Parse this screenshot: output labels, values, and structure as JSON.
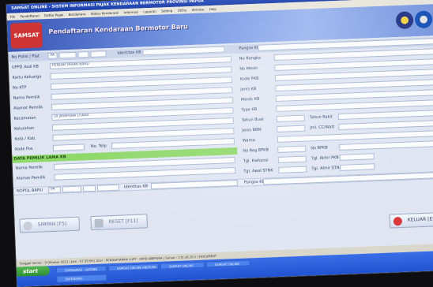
{
  "window": {
    "title": "SAMSAT ONLINE - SISTEM INFORMASI PAJAK KENDARAAN BERMOTOR PROVINSI PAPUA"
  },
  "menu": {
    "items": [
      "File",
      "Pendaftaran",
      "Daftar Pajak",
      "Bendahara",
      "Status Kendaraan",
      "Informasi",
      "Laporan",
      "Setting",
      "Utility",
      "Window",
      "Help"
    ]
  },
  "banner": {
    "logo_text": "SAMSAT",
    "title": "Pendaftaran Kendaraan Bermotor Baru",
    "emblem_1": "shield-emblem-icon",
    "emblem_2": "papua-emblem-icon"
  },
  "form": {
    "nopolisi_label": "No Polisi / Plat",
    "nopolisi_prefix": "PA",
    "identitas_kb_label": "Identitas KB",
    "pangsa_kb_label": "Pangsa KB",
    "uppd_label": "UPPD Asal KB",
    "uppd_value": "PENDAFTARAN BARU",
    "kk_label": "Kartu Keluarga",
    "ktp_label": "No KTP",
    "nama_label": "Nama Pemilik",
    "alamat_label": "Alamat Pemilik",
    "kecamatan_label": "Kecamatan",
    "kecamatan_value": "DI JAYAPURA UTARA",
    "kelurahan_label": "Kelurahan",
    "kota_label": "Kota / Kab.",
    "kodepos_label": "Kode Pos",
    "notelp_label": "No. Telp",
    "right_labels": [
      "No Rangka",
      "No Mesin",
      "Kode PKB",
      "Jenis KB",
      "Merek KB",
      "Type KB",
      "Tahun Buat",
      "Jenis BBM",
      "Warna",
      "No Reg BPKB",
      "Tgl. Kwitansi",
      "Tgl. Awal STNK"
    ],
    "tahun_rakit_label": "Tahun Rakit",
    "jml_cc_label": "Jml. CC/Watt",
    "no_bpkb_label": "No BPKB",
    "tgl_akhir_pkb_label": "Tgl. Akhir PKB",
    "tgl_akhir_stnk_label": "Tgl. Akhir STNK",
    "section_label": "DATA PEMILIK LAMA KB",
    "nama_lama_label": "Nama Pemilik",
    "alamat_lama_label": "Alamat Pemilik",
    "nopol_baru_label": "NOPOL BARU",
    "nopol_baru_prefix": "PA",
    "identitas_kb2_label": "Identitas KB",
    "pangsa_kb2_label": "Pangsa KB"
  },
  "buttons": {
    "simpan": "SIMPAN [F5]",
    "reset": "RESET [F11]",
    "keluar": "KELUAR [ESC]"
  },
  "statusbar": {
    "text": "Tanggal Server : 9 Oktober 2012 | Jam : 07:35:00 | User : PENDAFTARAN | UPT : UPPD ABEPURA | Server : 172.16.10.1 | DOCUMENT"
  },
  "taskbar": {
    "start": "start",
    "tasks": [
      "SIMTAKMAS - DATABB",
      "SAMSAT ONLINE ABEPURA",
      "SAMSAT ONLINE",
      "SAMSAT ONLINE"
    ],
    "second_row_task": "SIMTAKMAS"
  },
  "colors": {
    "section_green": "#8fd86a",
    "banner_blue": "#3a57b6",
    "logo_red": "#cf3434",
    "taskbar_blue": "#2152d0"
  }
}
